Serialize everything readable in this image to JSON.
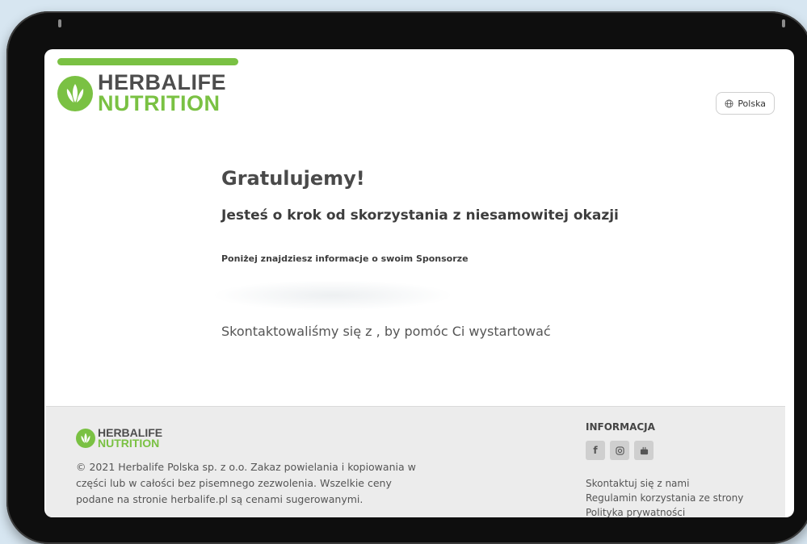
{
  "header": {
    "logo_line1": "HERBALIFE",
    "logo_line2": "NUTRITION",
    "language_label": "Polska"
  },
  "main": {
    "title": "Gratulujemy!",
    "subtitle": "Jesteś o krok od skorzystania z niesamowitej okazji",
    "sponsor_info": "Poniżej znajdziesz informacje o swoim Sponsorze",
    "contact_text": "Skontaktowaliśmy się z , by pomóc Ci wystartować"
  },
  "footer": {
    "logo_line1": "HERBALIFE",
    "logo_line2": "NUTRITION",
    "copyright": "© 2021 Herbalife Polska sp. z o.o. Zakaz powielania i kopiowania w części lub w całości bez pisemnego zezwolenia. Wszelkie ceny podane na stronie herbalife.pl są cenami sugerowanymi.",
    "info_heading": "INFORMACJA",
    "links": [
      "Skontaktuj się z nami",
      "Regulamin korzystania ze strony",
      "Polityka prywatności"
    ],
    "social_icons": [
      "facebook-icon",
      "instagram-icon",
      "youtube-icon"
    ]
  },
  "colors": {
    "brand_green": "#7ac143",
    "brand_gray": "#4d4d4d"
  }
}
